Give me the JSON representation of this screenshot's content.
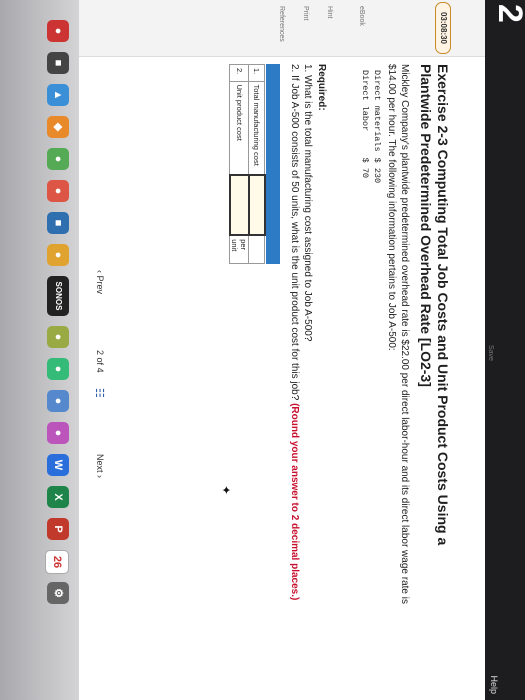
{
  "topbar": {
    "question_number": "2",
    "help_label": "Help",
    "center_label": "Save"
  },
  "sidebar": {
    "timer": "03:08:30",
    "items": [
      "eBook",
      "Hint",
      "Print",
      "References"
    ]
  },
  "exercise": {
    "title": "Exercise 2-3 Computing Total Job Costs and Unit Product Costs Using a Plantwide Predetermined Overhead Rate [LO2-3]",
    "intro": "Mickley Company's plantwide predetermined overhead rate is $22.00 per direct labor-hour and its direct labor wage rate is $14.00 per hour. The following information pertains to Job A-500:",
    "cost_table": [
      {
        "label": "Direct materials",
        "value": "$ 230"
      },
      {
        "label": "Direct labor",
        "value": "$  70"
      }
    ],
    "required_heading": "Required:",
    "required_1": "1. What is the total manufacturing cost assigned to Job A-500?",
    "required_2_text": "2. If Job A-500 consists of 50 units, what is the unit product cost for this job?",
    "required_2_note": "(Round your answer to 2 decimal places.)"
  },
  "answer_table": {
    "rows": [
      {
        "num": "1.",
        "label": "Total manufacturing cost",
        "value": "",
        "unit": ""
      },
      {
        "num": "2.",
        "label": "Unit product cost",
        "value": "",
        "unit": "per unit"
      }
    ]
  },
  "pager": {
    "prev_label": "Prev",
    "current": "2",
    "of_label": "of",
    "total": "4",
    "next_label": "Next"
  },
  "dock": {
    "sonos_label": "SONOS",
    "calendar_day": "26"
  }
}
